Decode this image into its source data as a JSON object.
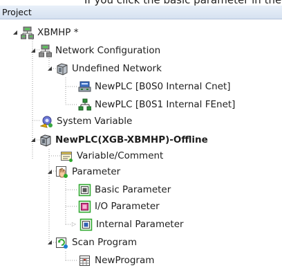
{
  "top_cutoff_text": "If you click the basic parameter in the",
  "panel": {
    "title": "Project"
  },
  "tree": {
    "root_label": "XBMHP *",
    "network_configuration": "Network Configuration",
    "undefined_network": "Undefined Network",
    "plc_cnet": "NewPLC [B0S0 Internal Cnet]",
    "plc_fenet": "NewPLC [B0S1 Internal FEnet]",
    "system_variable": "System Variable",
    "plc_offline": "NewPLC(XGB-XBMHP)-Offline",
    "variable_comment": "Variable/Comment",
    "parameter": "Parameter",
    "basic_parameter": "Basic Parameter",
    "io_parameter": "I/O Parameter",
    "internal_parameter": "Internal Parameter",
    "scan_program": "Scan Program",
    "new_program": "NewProgram"
  },
  "toggles": {
    "expanded": "◢",
    "collapsed": "▷"
  },
  "icons": {
    "root": "project-network-icon",
    "network_configuration": "network-configuration-icon",
    "undefined_network": "network-folder-icon",
    "plc_cnet": "serial-cnet-icon",
    "plc_fenet": "ethernet-fenet-icon",
    "system_variable": "system-variable-icon",
    "plc": "plc-cpu-icon",
    "variable_comment": "variable-comment-icon",
    "parameter": "parameter-icon",
    "basic_parameter": "basic-parameter-icon",
    "io_parameter": "io-parameter-icon",
    "internal_parameter": "internal-parameter-icon",
    "scan_program": "scan-program-icon",
    "new_program": "program-icon"
  },
  "colors": {
    "header_bg": "#dce6f3",
    "tree_line": "#9c9c9c",
    "selection_green": "#2ea82e"
  }
}
